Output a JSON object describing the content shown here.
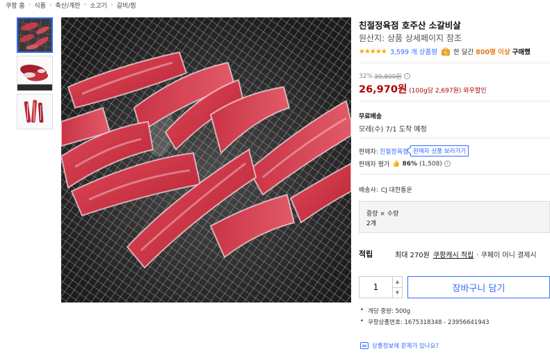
{
  "breadcrumb": [
    "쿠팡 홈",
    "식품",
    "축산/계란",
    "소고기",
    "갈비/찜"
  ],
  "product": {
    "title": "친절정육점 호주산 소갈비살",
    "origin": "원산지: 상품 상세페이지 참조",
    "stars": "★★★★★",
    "rating_value": 4.5,
    "review_count": "3,599 개 상품평",
    "repurchase_pre": "한 달간",
    "repurchase_count": "800명 이상",
    "repurchase_post": "구매했",
    "discount_rate": "32%",
    "original_price": "39,800원",
    "sale_price": "26,970원",
    "unit_price": "(100g당 2,697원)",
    "wow_label": "와우할인"
  },
  "shipping": {
    "label": "무료배송",
    "arrival": "모레(수) 7/1 도착 예정"
  },
  "seller": {
    "label": "판매자:",
    "name": "친절정육점",
    "more_button": "판매자 상품 보러가기",
    "rating_label": "판매자 평가",
    "rating_pct": "86%",
    "rating_count": "(1,508)"
  },
  "delivery": {
    "label": "배송사:",
    "company": "CJ 대한통운"
  },
  "option": {
    "label": "중량 × 수량",
    "value": "2개"
  },
  "cash": {
    "label": "적립",
    "max": "최대 270원",
    "link": "쿠팡캐시 적립",
    "rest": "· 쿠페이 머니 결제시"
  },
  "purchase": {
    "quantity": "1",
    "cart_button": "장바구니 담기"
  },
  "facts": [
    "개당 중량: 500g",
    "쿠팡상품번호: 1675318348 - 23956641943"
  ],
  "report_link": "상품정보에 문제가 있나요?",
  "colors": {
    "accent": "#346aff",
    "price": "#ae0000",
    "star": "#f6a609",
    "repurchase": "#e47a1a"
  },
  "icons": {
    "info": "info-icon",
    "thumbs_up": "thumbs-up-icon",
    "report": "report-icon",
    "repurchase": "repurchase-icon"
  }
}
